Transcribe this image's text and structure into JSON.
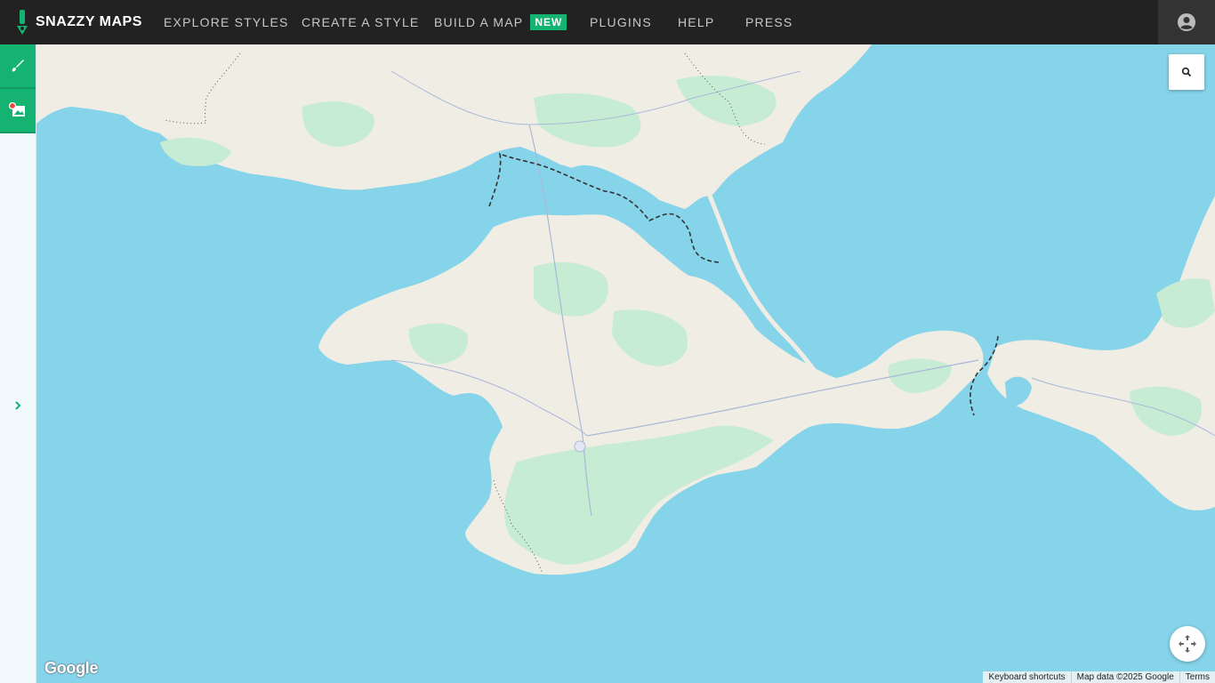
{
  "brand": {
    "name": "SNAZZY MAPS",
    "accent": "#15b372"
  },
  "nav": {
    "items": [
      {
        "label": "EXPLORE STYLES"
      },
      {
        "label": "CREATE A STYLE"
      },
      {
        "label": "BUILD A MAP",
        "badge": "NEW"
      },
      {
        "label": "PLUGINS"
      },
      {
        "label": "HELP"
      },
      {
        "label": "PRESS"
      }
    ]
  },
  "icons": {
    "account": "account-circle-icon",
    "edit": "paintbrush-icon",
    "image": "image-icon",
    "expand": "chevron-right-icon",
    "search": "search-icon",
    "fullscreen": "fullscreen-icon"
  },
  "map": {
    "water_color": "#86d4ea",
    "land_color": "#f0ede4",
    "green_color": "#c6ecd4",
    "google_logo": "Google",
    "attribution": {
      "shortcuts": "Keyboard shortcuts",
      "data": "Map data ©2025 Google",
      "terms": "Terms"
    }
  }
}
